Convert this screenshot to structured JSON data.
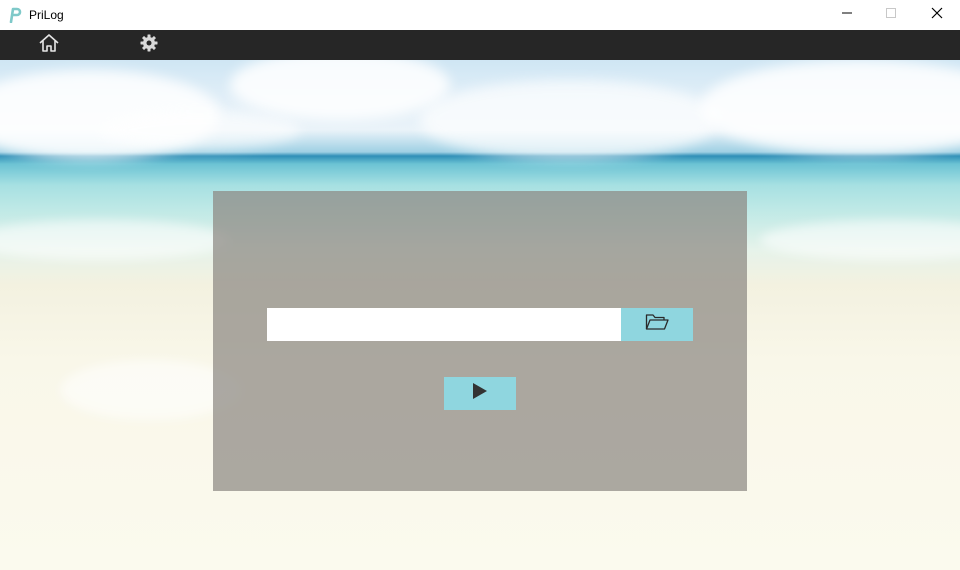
{
  "window": {
    "title": "PriLog",
    "icon": "prilog-logo-icon",
    "controls": [
      "minimize-icon",
      "maximize-icon",
      "close-icon"
    ]
  },
  "toolbar": {
    "items": [
      {
        "icon": "home-icon"
      },
      {
        "icon": "gear-icon"
      }
    ]
  },
  "main": {
    "file_input": {
      "value": "",
      "placeholder": ""
    },
    "browse_icon": "folder-open-icon",
    "run_icon": "play-icon"
  },
  "colors": {
    "titlebar": "#ffffff",
    "toolbar": "#262626",
    "accent": "#8fd6df",
    "panel": "rgba(140,136,130,0.72)",
    "logo": "#7fc9c9"
  }
}
